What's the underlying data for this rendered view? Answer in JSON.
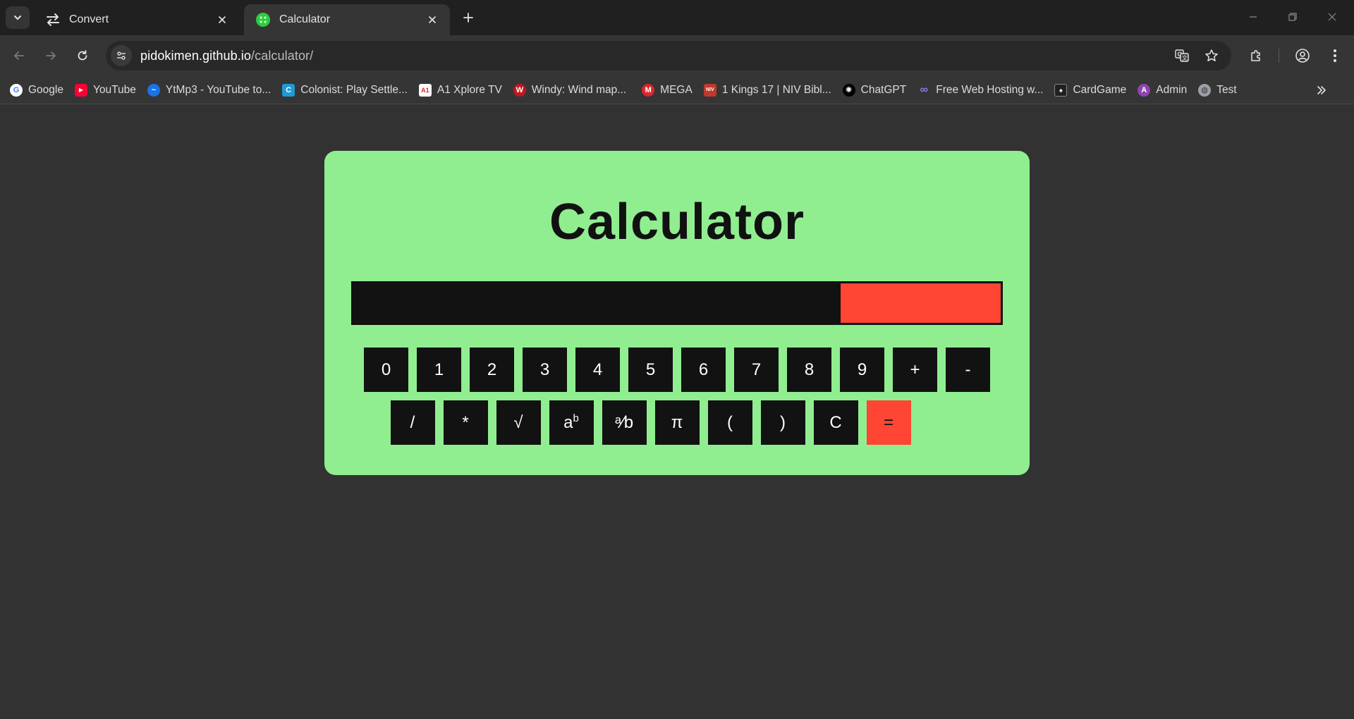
{
  "browser": {
    "tabs": [
      {
        "title": "Convert",
        "active": false,
        "icon": "arrows-swap-icon"
      },
      {
        "title": "Calculator",
        "active": true,
        "icon": "calculator-favicon"
      }
    ],
    "url_host": "pidokimen.github.io",
    "url_path": "/calculator/",
    "bookmarks": [
      {
        "label": "Google",
        "icon": "google-icon",
        "color": "#ffffff"
      },
      {
        "label": "YouTube",
        "icon": "youtube-icon",
        "color": "#ff0033"
      },
      {
        "label": "YtMp3 - YouTube to...",
        "icon": "ytmp3-icon",
        "color": "#1a73e8"
      },
      {
        "label": "Colonist: Play Settle...",
        "icon": "colonist-icon",
        "color": "#1e9bd7"
      },
      {
        "label": "A1 Xplore TV",
        "icon": "a1-icon",
        "color": "#ffffff"
      },
      {
        "label": "Windy: Wind map...",
        "icon": "windy-icon",
        "color": "#c4161c"
      },
      {
        "label": "MEGA",
        "icon": "mega-icon",
        "color": "#d9272e"
      },
      {
        "label": "1 Kings 17 | NIV Bibl...",
        "icon": "bible-icon",
        "color": "#c0392b"
      },
      {
        "label": "ChatGPT",
        "icon": "chatgpt-icon",
        "color": "#000000"
      },
      {
        "label": "Free Web Hosting w...",
        "icon": "infinity-icon",
        "color": "#6a5acd"
      },
      {
        "label": "CardGame",
        "icon": "cardgame-icon",
        "color": "#202020"
      },
      {
        "label": "Admin",
        "icon": "admin-icon",
        "color": "#8e44ad"
      },
      {
        "label": "Test",
        "icon": "globe-icon",
        "color": "#9aa0a6"
      }
    ]
  },
  "calculator": {
    "title": "Calculator",
    "display_value": "",
    "colors": {
      "panel": "#90ee90",
      "key": "#121212",
      "accent": "#ff4533"
    },
    "row1": [
      "0",
      "1",
      "2",
      "3",
      "4",
      "5",
      "6",
      "7",
      "8",
      "9",
      "+",
      "-"
    ],
    "row2": [
      "/",
      "*",
      "√",
      "a",
      "ᵃ⁄b",
      "π",
      "(",
      ")",
      "C",
      "="
    ],
    "power_sup": "b"
  }
}
